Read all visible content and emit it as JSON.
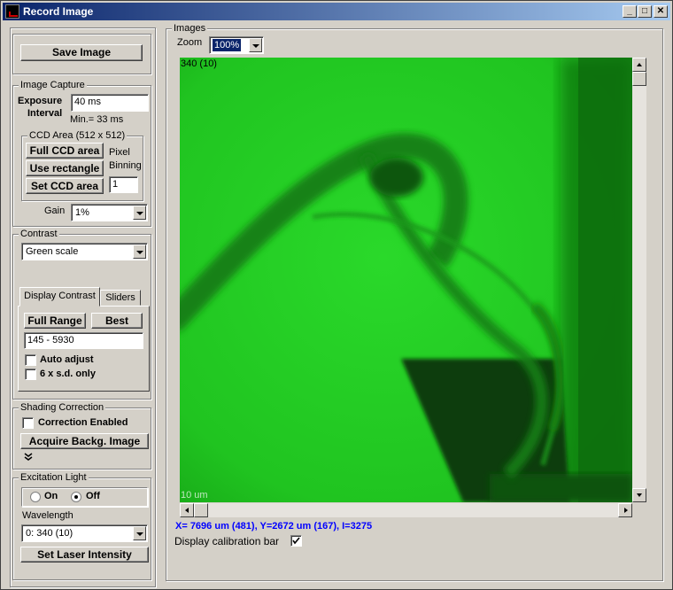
{
  "window": {
    "title": "Record Image",
    "title_buttons": [
      "_",
      "□",
      "✕"
    ]
  },
  "left": {
    "save_button": "Save Image",
    "capture": {
      "legend": "Image Capture",
      "exposure_label_1": "Exposure",
      "exposure_label_2": "Interval",
      "exposure_value": "40 ms",
      "min_text": "Min.= 33 ms",
      "ccd": {
        "legend": "CCD Area (512 x 512)",
        "full_button": "Full CCD area",
        "rect_button": "Use rectangle",
        "set_button": "Set CCD area",
        "pixel_label": "Pixel",
        "binning_label": "Binning",
        "binning_value": "1"
      },
      "gain_label": "Gain",
      "gain_value": "1%"
    },
    "contrast": {
      "legend": "Contrast",
      "palette": "Green scale",
      "tabs": [
        "Display Contrast",
        "Sliders"
      ],
      "full_range_button": "Full Range",
      "best_button": "Best",
      "range_value": "145 - 5930",
      "auto_adjust": {
        "label": "Auto adjust",
        "checked": false
      },
      "sd_only": {
        "label": "6 x s.d. only",
        "checked": false
      }
    },
    "shading": {
      "legend": "Shading Correction",
      "correction": {
        "label": "Correction Enabled",
        "checked": false
      },
      "acquire_button": "Acquire Backg. Image",
      "expand_icon": "double-chevron-down"
    },
    "excitation": {
      "legend": "Excitation Light",
      "on_label": "On",
      "off_label": "Off",
      "selected": "Off",
      "wavelength_label": "Wavelength",
      "wavelength_value": "0: 340 (10)",
      "laser_button": "Set Laser Intensity"
    }
  },
  "images": {
    "legend": "Images",
    "zoom_label": "Zoom",
    "zoom_value": "100%",
    "overlay_label": "340 (10)",
    "scale_label": "10 um",
    "cursor_readout": "X= 7696 um (481), Y=2672 um (167), I=3275",
    "calibration": {
      "label": "Display calibration bar",
      "checked": true
    },
    "accent_color": "#0000ff",
    "image_colors": {
      "bright": "#22d422",
      "dark": "#0a3a0a"
    }
  }
}
